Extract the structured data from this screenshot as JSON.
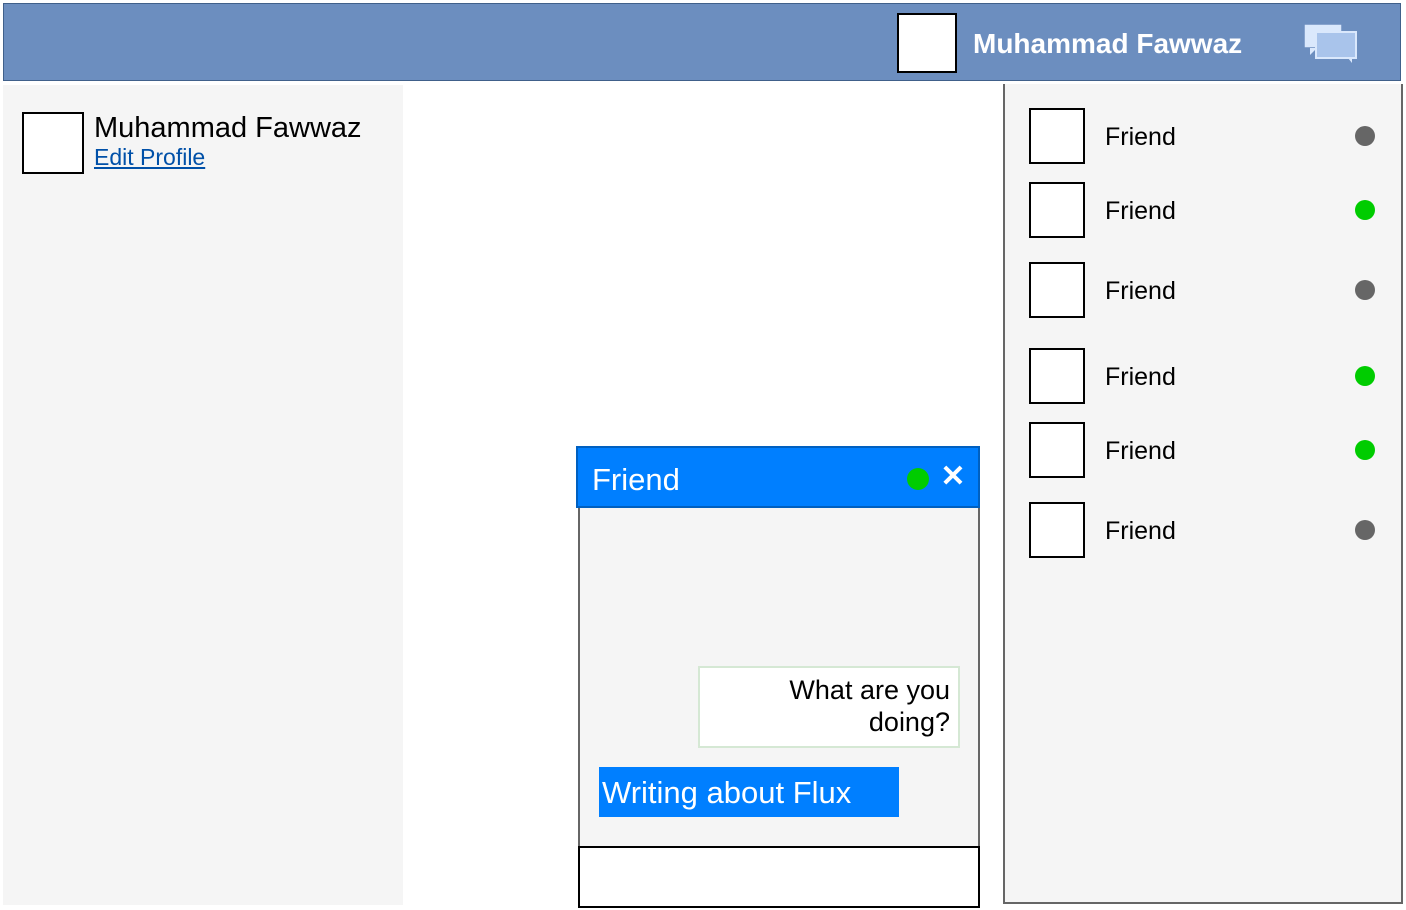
{
  "colors": {
    "header_bg": "#6c8ebf",
    "accent_blue": "#007fff",
    "panel_bg": "#f5f5f5",
    "online": "#00cc00",
    "offline": "#666666",
    "link": "#0050a8"
  },
  "header": {
    "user_name": "Muhammad Fawwaz",
    "chat_icon": "chat-bubbles-icon"
  },
  "profile": {
    "name": "Muhammad Fawwaz",
    "edit_link": "Edit Profile"
  },
  "friends": [
    {
      "name": "Friend",
      "status": "offline"
    },
    {
      "name": "Friend",
      "status": "online"
    },
    {
      "name": "Friend",
      "status": "offline"
    },
    {
      "name": "Friend",
      "status": "online"
    },
    {
      "name": "Friend",
      "status": "online"
    },
    {
      "name": "Friend",
      "status": "offline"
    }
  ],
  "chat": {
    "title": "Friend",
    "status": "online",
    "close_icon": "close-icon",
    "close_glyph": "✕",
    "messages": [
      {
        "from": "friend",
        "text": "What are you doing?"
      },
      {
        "from": "me",
        "text": "Writing about Flux"
      }
    ],
    "input_value": "",
    "input_placeholder": ""
  }
}
